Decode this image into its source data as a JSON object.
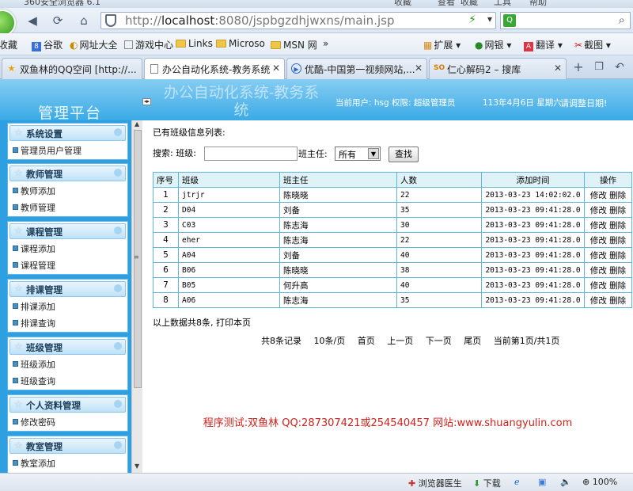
{
  "browser": {
    "title": "360安全浏览器 6.1",
    "title_menus": [
      "收藏",
      "查看",
      "收藏",
      "工具",
      "帮助"
    ],
    "url_host": "localhost",
    "url_rest": ":8080/jspbgzdhjwxns/main.jsp",
    "url_prefix": "http://",
    "bookmarks": [
      "收藏",
      "谷歌",
      "网址大全",
      "游戏中心",
      "Links",
      "Microso",
      "MSN 网"
    ],
    "bookmarks_overflow": "»",
    "tools": [
      "扩展",
      "网银",
      "翻译",
      "截图"
    ],
    "tabs": [
      {
        "label": "双鱼林的QQ空间 [http://..."
      },
      {
        "label": "办公自动化系统-教务系统"
      },
      {
        "label": "优酷-中国第一视频网站,..."
      },
      {
        "label": "仁心解码2 – 搜库"
      }
    ],
    "status": {
      "doctor": "浏览器医生",
      "download": "下载",
      "zoom": "100%"
    }
  },
  "header": {
    "platform": "管理平台",
    "system_title": "办公自动化系统-教务系统",
    "user_info": "当前用户: hsg 权限: 超级管理员",
    "date": "113年4月6日 星期六",
    "adjust": "请调整日期!"
  },
  "sidebar": {
    "groups": [
      {
        "title": "系统设置",
        "items": [
          "管理员用户管理"
        ]
      },
      {
        "title": "教师管理",
        "items": [
          "教师添加",
          "教师管理"
        ]
      },
      {
        "title": "课程管理",
        "items": [
          "课程添加",
          "课程管理"
        ]
      },
      {
        "title": "排课管理",
        "items": [
          "排课添加",
          "排课查询"
        ]
      },
      {
        "title": "班级管理",
        "items": [
          "班级添加",
          "班级查询"
        ]
      },
      {
        "title": "个人资料管理",
        "items": [
          "修改密码"
        ]
      },
      {
        "title": "教室管理",
        "items": [
          "教室添加"
        ]
      }
    ]
  },
  "main": {
    "list_title": "已有班级信息列表:",
    "search_label": "搜索: 班级:",
    "teacher_label": "班主任:",
    "teacher_select": "所有",
    "search_button": "查找",
    "columns": [
      "序号",
      "班级",
      "班主任",
      "人数",
      "添加时间",
      "操作"
    ],
    "rows": [
      [
        "1",
        "jtrjr",
        "陈晓晓",
        "22",
        "2013-03-23 14:02:02.0"
      ],
      [
        "2",
        "D04",
        "刘备",
        "35",
        "2013-03-23 09:41:28.0"
      ],
      [
        "3",
        "C03",
        "陈志海",
        "30",
        "2013-03-23 09:41:28.0"
      ],
      [
        "4",
        "eher",
        "陈志海",
        "22",
        "2013-03-23 09:41:28.0"
      ],
      [
        "5",
        "A04",
        "刘备",
        "40",
        "2013-03-23 09:41:28.0"
      ],
      [
        "6",
        "B06",
        "陈晓晓",
        "38",
        "2013-03-23 09:41:28.0"
      ],
      [
        "7",
        "B05",
        "何升高",
        "40",
        "2013-03-23 09:41:28.0"
      ],
      [
        "8",
        "A06",
        "陈志海",
        "35",
        "2013-03-23 09:41:28.0"
      ]
    ],
    "edit_label": "修改",
    "delete_label": "删除",
    "summary": "以上数据共8条, 打印本页",
    "pager": [
      "共8条记录",
      "10条/页",
      "首页",
      "上一页",
      "下一页",
      "尾页",
      "当前第1页/共1页"
    ],
    "footer": "程序测试:双鱼林 QQ:287307421或254540457 网站:www.shuangyulin.com"
  }
}
